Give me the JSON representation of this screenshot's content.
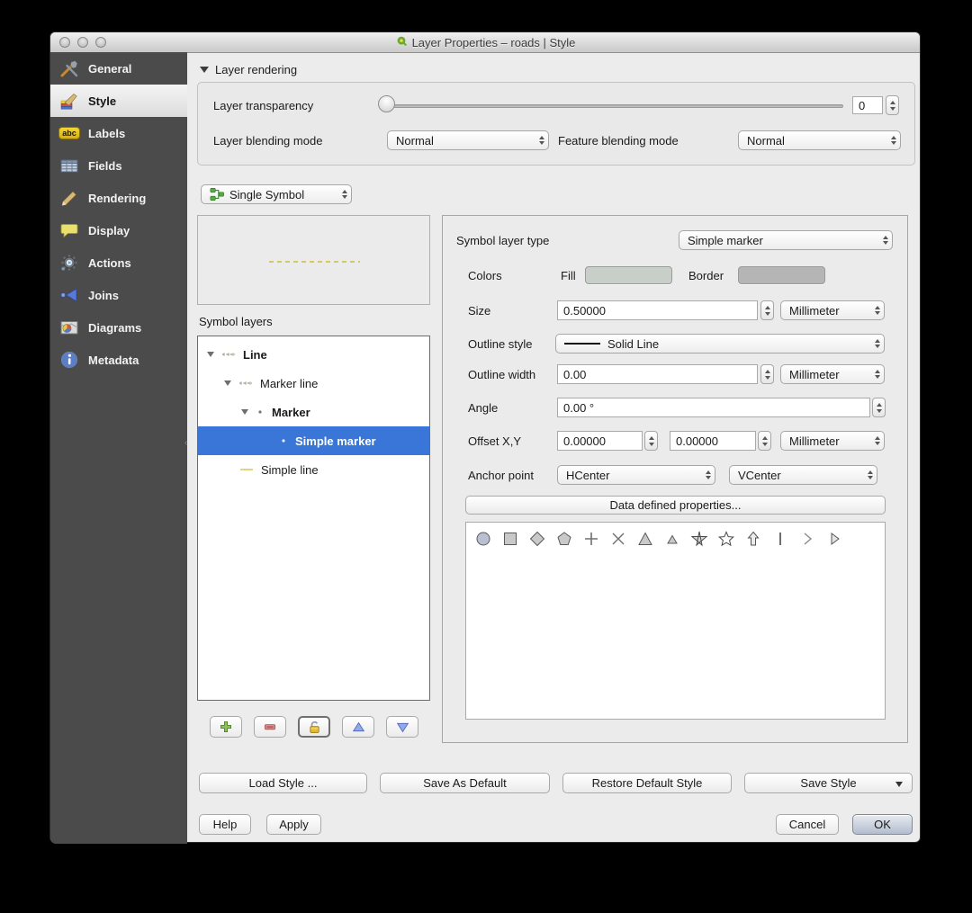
{
  "window": {
    "title": "Layer Properties – roads | Style"
  },
  "sidebar": {
    "items": [
      {
        "label": "General"
      },
      {
        "label": "Style"
      },
      {
        "label": "Labels",
        "badge": "abc"
      },
      {
        "label": "Fields"
      },
      {
        "label": "Rendering"
      },
      {
        "label": "Display"
      },
      {
        "label": "Actions"
      },
      {
        "label": "Joins"
      },
      {
        "label": "Diagrams"
      },
      {
        "label": "Metadata"
      }
    ]
  },
  "layer_rendering": {
    "header": "Layer rendering",
    "transparency_label": "Layer transparency",
    "transparency_value": "0",
    "layer_blending_label": "Layer blending mode",
    "layer_blending_value": "Normal",
    "feature_blending_label": "Feature blending mode",
    "feature_blending_value": "Normal"
  },
  "renderer": {
    "value": "Single Symbol"
  },
  "symbol_layers": {
    "label": "Symbol layers",
    "tree": [
      {
        "label": "Line"
      },
      {
        "label": "Marker line"
      },
      {
        "label": "Marker"
      },
      {
        "label": "Simple marker"
      },
      {
        "label": "Simple line"
      }
    ]
  },
  "properties": {
    "symbol_layer_type_label": "Symbol layer type",
    "symbol_layer_type_value": "Simple marker",
    "colors_label": "Colors",
    "fill_label": "Fill",
    "border_label": "Border",
    "fill_color": "#c8cfc8",
    "border_color": "#b5b5b5",
    "size_label": "Size",
    "size_value": "0.50000",
    "size_unit": "Millimeter",
    "outline_style_label": "Outline style",
    "outline_style_value": "Solid Line",
    "outline_width_label": "Outline width",
    "outline_width_value": "0.00",
    "outline_width_unit": "Millimeter",
    "angle_label": "Angle",
    "angle_value": "0.00 °",
    "offset_label": "Offset X,Y",
    "offset_x_value": "0.00000",
    "offset_y_value": "0.00000",
    "offset_unit": "Millimeter",
    "anchor_label": "Anchor point",
    "anchor_h_value": "HCenter",
    "anchor_v_value": "VCenter",
    "data_defined_button": "Data defined properties...",
    "marker_shapes": [
      "circle",
      "square",
      "diamond",
      "pentagon",
      "cross",
      "cross2",
      "triangle",
      "equilateral-triangle",
      "star-crossed",
      "star",
      "arrow",
      "line",
      "chevron",
      "arrowhead"
    ]
  },
  "style_buttons": {
    "load_style": "Load Style ...",
    "save_as_default": "Save As Default",
    "restore_default": "Restore Default Style",
    "save_style": "Save Style"
  },
  "dialog_buttons": {
    "help": "Help",
    "apply": "Apply",
    "cancel": "Cancel",
    "ok": "OK"
  }
}
